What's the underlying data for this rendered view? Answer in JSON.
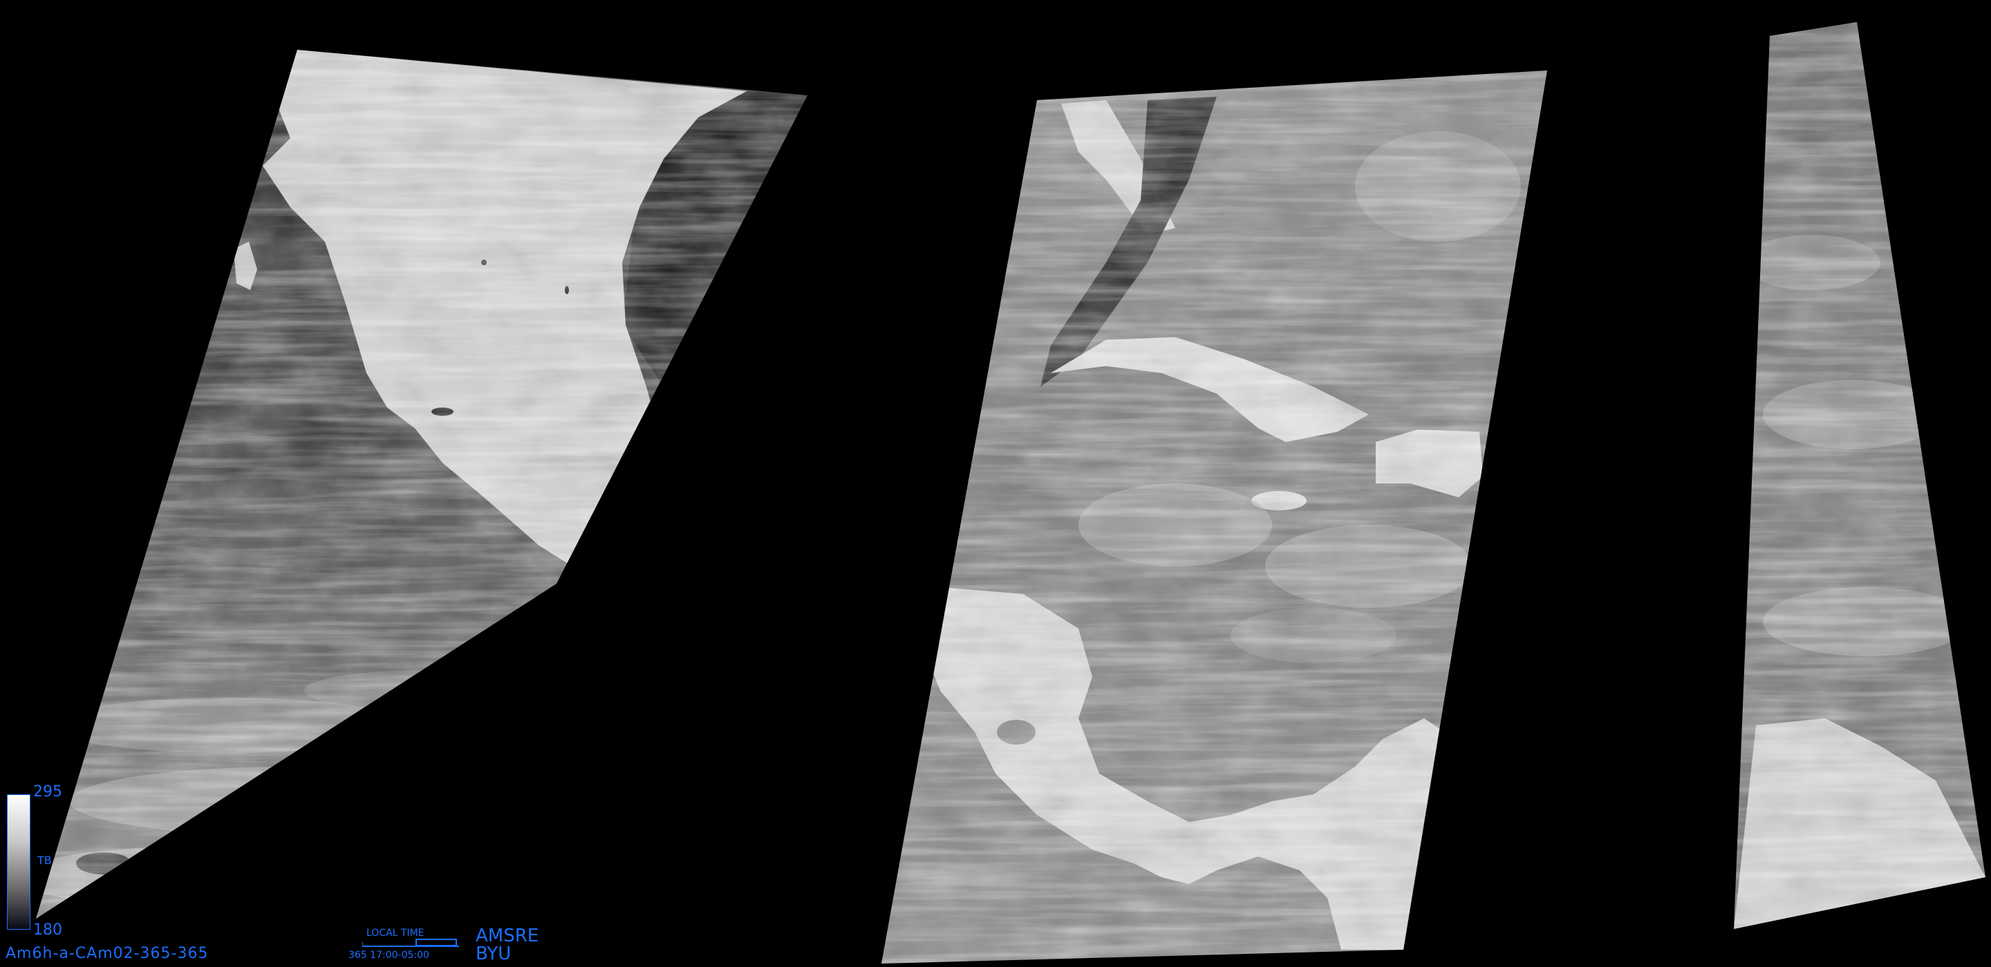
{
  "colorbar": {
    "max_label": "295",
    "mid_label": "TB",
    "min_label": "180"
  },
  "image_id": "Am6h-a-CAm02-365-365",
  "local_time": {
    "label": "LOCAL TIME",
    "value": "365 17:00-05:00"
  },
  "sensor": "AMSRE",
  "organization": "BYU",
  "colors": {
    "text_accent": "#1a6fff",
    "background": "#000000"
  }
}
